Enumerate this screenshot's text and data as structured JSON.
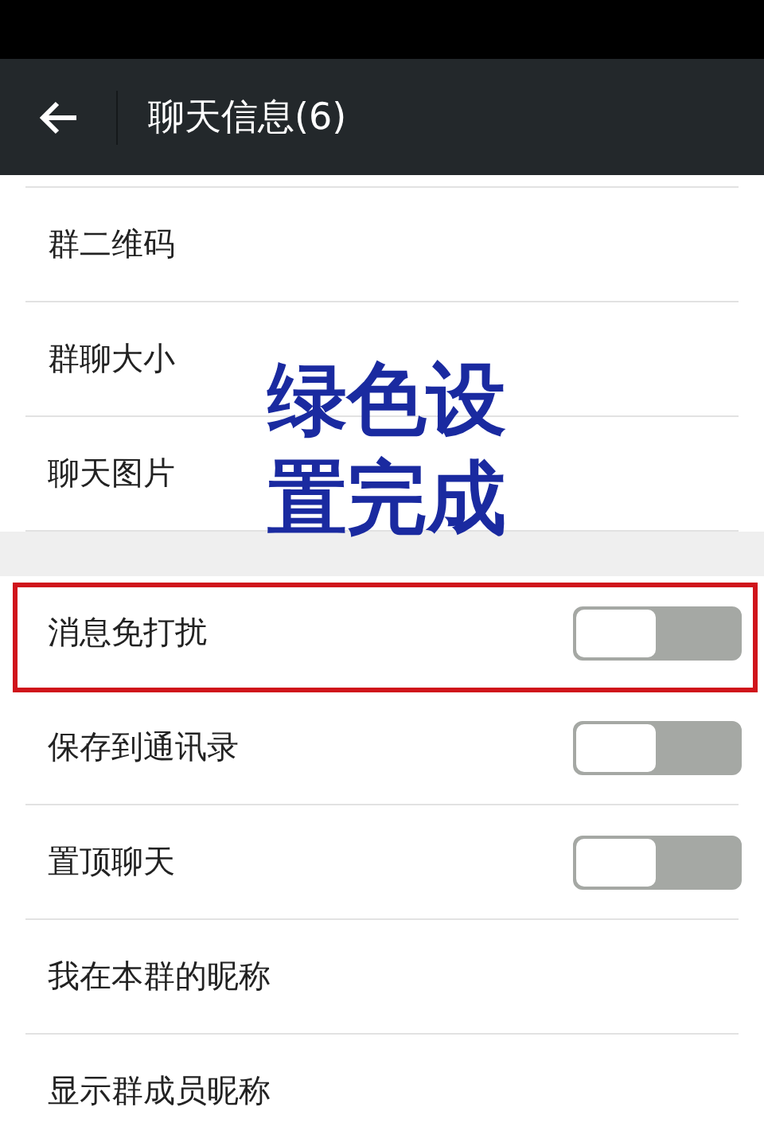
{
  "header": {
    "title": "聊天信息(6)"
  },
  "sections": [
    {
      "items": [
        {
          "label": "群二维码",
          "kind": "link"
        },
        {
          "label": "群聊大小",
          "kind": "link"
        },
        {
          "label": "聊天图片",
          "kind": "link"
        }
      ]
    },
    {
      "items": [
        {
          "label": "消息免打扰",
          "kind": "switch",
          "on": false,
          "highlighted": true
        },
        {
          "label": "保存到通讯录",
          "kind": "switch",
          "on": false,
          "highlighted": false
        },
        {
          "label": "置顶聊天",
          "kind": "switch",
          "on": false,
          "highlighted": false
        },
        {
          "label": "我在本群的昵称",
          "kind": "link"
        },
        {
          "label": "显示群成员昵称",
          "kind": "link"
        }
      ]
    }
  ],
  "annotation": {
    "lines": [
      "绿色设",
      "置完成"
    ]
  }
}
